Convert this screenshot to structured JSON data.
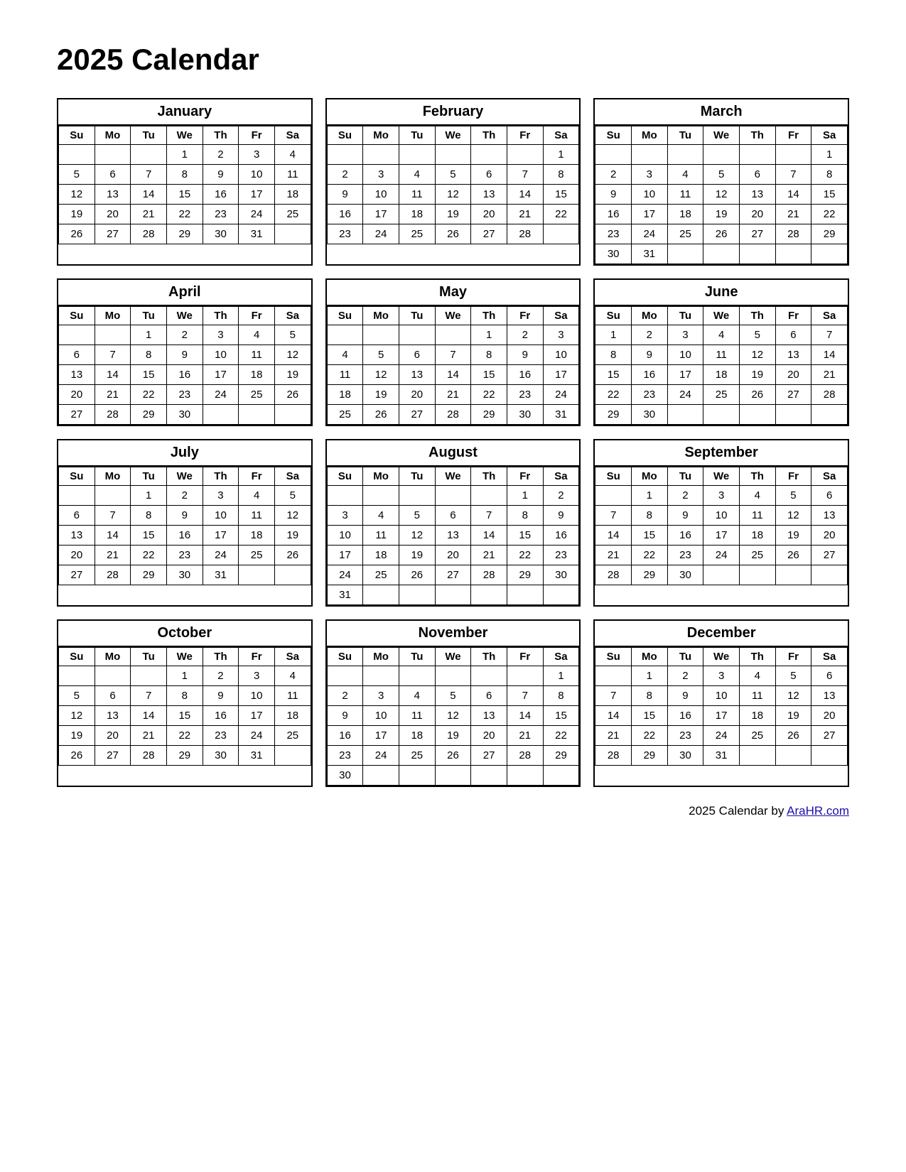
{
  "title": "2025 Calendar",
  "footer": {
    "text": "2025  Calendar by ",
    "link_text": "AraHR.com",
    "link_href": "https://AraHR.com"
  },
  "days_header": [
    "Su",
    "Mo",
    "Tu",
    "We",
    "Th",
    "Fr",
    "Sa"
  ],
  "months": [
    {
      "name": "January",
      "weeks": [
        [
          "",
          "",
          "",
          "1",
          "2",
          "3",
          "4"
        ],
        [
          "5",
          "6",
          "7",
          "8",
          "9",
          "10",
          "11"
        ],
        [
          "12",
          "13",
          "14",
          "15",
          "16",
          "17",
          "18"
        ],
        [
          "19",
          "20",
          "21",
          "22",
          "23",
          "24",
          "25"
        ],
        [
          "26",
          "27",
          "28",
          "29",
          "30",
          "31",
          ""
        ]
      ]
    },
    {
      "name": "February",
      "weeks": [
        [
          "",
          "",
          "",
          "",
          "",
          "",
          "1"
        ],
        [
          "2",
          "3",
          "4",
          "5",
          "6",
          "7",
          "8"
        ],
        [
          "9",
          "10",
          "11",
          "12",
          "13",
          "14",
          "15"
        ],
        [
          "16",
          "17",
          "18",
          "19",
          "20",
          "21",
          "22"
        ],
        [
          "23",
          "24",
          "25",
          "26",
          "27",
          "28",
          ""
        ]
      ]
    },
    {
      "name": "March",
      "weeks": [
        [
          "",
          "",
          "",
          "",
          "",
          "",
          "1"
        ],
        [
          "2",
          "3",
          "4",
          "5",
          "6",
          "7",
          "8"
        ],
        [
          "9",
          "10",
          "11",
          "12",
          "13",
          "14",
          "15"
        ],
        [
          "16",
          "17",
          "18",
          "19",
          "20",
          "21",
          "22"
        ],
        [
          "23",
          "24",
          "25",
          "26",
          "27",
          "28",
          "29"
        ],
        [
          "30",
          "31",
          "",
          "",
          "",
          "",
          ""
        ]
      ]
    },
    {
      "name": "April",
      "weeks": [
        [
          "",
          "",
          "1",
          "2",
          "3",
          "4",
          "5"
        ],
        [
          "6",
          "7",
          "8",
          "9",
          "10",
          "11",
          "12"
        ],
        [
          "13",
          "14",
          "15",
          "16",
          "17",
          "18",
          "19"
        ],
        [
          "20",
          "21",
          "22",
          "23",
          "24",
          "25",
          "26"
        ],
        [
          "27",
          "28",
          "29",
          "30",
          "",
          "",
          ""
        ]
      ]
    },
    {
      "name": "May",
      "weeks": [
        [
          "",
          "",
          "",
          "",
          "1",
          "2",
          "3"
        ],
        [
          "4",
          "5",
          "6",
          "7",
          "8",
          "9",
          "10"
        ],
        [
          "11",
          "12",
          "13",
          "14",
          "15",
          "16",
          "17"
        ],
        [
          "18",
          "19",
          "20",
          "21",
          "22",
          "23",
          "24"
        ],
        [
          "25",
          "26",
          "27",
          "28",
          "29",
          "30",
          "31"
        ]
      ]
    },
    {
      "name": "June",
      "weeks": [
        [
          "1",
          "2",
          "3",
          "4",
          "5",
          "6",
          "7"
        ],
        [
          "8",
          "9",
          "10",
          "11",
          "12",
          "13",
          "14"
        ],
        [
          "15",
          "16",
          "17",
          "18",
          "19",
          "20",
          "21"
        ],
        [
          "22",
          "23",
          "24",
          "25",
          "26",
          "27",
          "28"
        ],
        [
          "29",
          "30",
          "",
          "",
          "",
          "",
          ""
        ]
      ]
    },
    {
      "name": "July",
      "weeks": [
        [
          "",
          "",
          "1",
          "2",
          "3",
          "4",
          "5"
        ],
        [
          "6",
          "7",
          "8",
          "9",
          "10",
          "11",
          "12"
        ],
        [
          "13",
          "14",
          "15",
          "16",
          "17",
          "18",
          "19"
        ],
        [
          "20",
          "21",
          "22",
          "23",
          "24",
          "25",
          "26"
        ],
        [
          "27",
          "28",
          "29",
          "30",
          "31",
          "",
          ""
        ]
      ]
    },
    {
      "name": "August",
      "weeks": [
        [
          "",
          "",
          "",
          "",
          "",
          "1",
          "2"
        ],
        [
          "3",
          "4",
          "5",
          "6",
          "7",
          "8",
          "9"
        ],
        [
          "10",
          "11",
          "12",
          "13",
          "14",
          "15",
          "16"
        ],
        [
          "17",
          "18",
          "19",
          "20",
          "21",
          "22",
          "23"
        ],
        [
          "24",
          "25",
          "26",
          "27",
          "28",
          "29",
          "30"
        ],
        [
          "31",
          "",
          "",
          "",
          "",
          "",
          ""
        ]
      ]
    },
    {
      "name": "September",
      "weeks": [
        [
          "",
          "1",
          "2",
          "3",
          "4",
          "5",
          "6"
        ],
        [
          "7",
          "8",
          "9",
          "10",
          "11",
          "12",
          "13"
        ],
        [
          "14",
          "15",
          "16",
          "17",
          "18",
          "19",
          "20"
        ],
        [
          "21",
          "22",
          "23",
          "24",
          "25",
          "26",
          "27"
        ],
        [
          "28",
          "29",
          "30",
          "",
          "",
          "",
          ""
        ]
      ]
    },
    {
      "name": "October",
      "weeks": [
        [
          "",
          "",
          "",
          "1",
          "2",
          "3",
          "4"
        ],
        [
          "5",
          "6",
          "7",
          "8",
          "9",
          "10",
          "11"
        ],
        [
          "12",
          "13",
          "14",
          "15",
          "16",
          "17",
          "18"
        ],
        [
          "19",
          "20",
          "21",
          "22",
          "23",
          "24",
          "25"
        ],
        [
          "26",
          "27",
          "28",
          "29",
          "30",
          "31",
          ""
        ]
      ]
    },
    {
      "name": "November",
      "weeks": [
        [
          "",
          "",
          "",
          "",
          "",
          "",
          "1"
        ],
        [
          "2",
          "3",
          "4",
          "5",
          "6",
          "7",
          "8"
        ],
        [
          "9",
          "10",
          "11",
          "12",
          "13",
          "14",
          "15"
        ],
        [
          "16",
          "17",
          "18",
          "19",
          "20",
          "21",
          "22"
        ],
        [
          "23",
          "24",
          "25",
          "26",
          "27",
          "28",
          "29"
        ],
        [
          "30",
          "",
          "",
          "",
          "",
          "",
          ""
        ]
      ]
    },
    {
      "name": "December",
      "weeks": [
        [
          "",
          "1",
          "2",
          "3",
          "4",
          "5",
          "6"
        ],
        [
          "7",
          "8",
          "9",
          "10",
          "11",
          "12",
          "13"
        ],
        [
          "14",
          "15",
          "16",
          "17",
          "18",
          "19",
          "20"
        ],
        [
          "21",
          "22",
          "23",
          "24",
          "25",
          "26",
          "27"
        ],
        [
          "28",
          "29",
          "30",
          "31",
          "",
          "",
          ""
        ]
      ]
    }
  ]
}
